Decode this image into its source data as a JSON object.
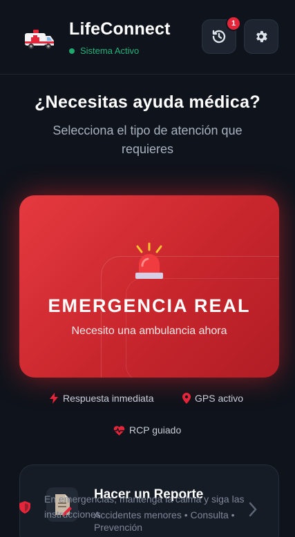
{
  "header": {
    "app_name": "LifeConnect",
    "status": "Sistema Activo",
    "history_badge": "1",
    "icons": {
      "logo": "ambulance-icon",
      "history": "history-icon",
      "settings": "gear-icon"
    }
  },
  "main": {
    "question": "¿Necesitas ayuda médica?",
    "subtitle": "Selecciona el tipo de atención que requieres"
  },
  "emergency": {
    "title": "EMERGENCIA REAL",
    "subtitle": "Necesito una ambulancia ahora",
    "icon": "siren-icon"
  },
  "features": [
    {
      "label": "Respuesta inmediata",
      "icon": "bolt-icon"
    },
    {
      "label": "GPS activo",
      "icon": "location-pin-icon"
    },
    {
      "label": "RCP guiado",
      "icon": "heartbeat-icon"
    }
  ],
  "report": {
    "title": "Hacer un Reporte",
    "subtitle": "Accidentes menores • Consulta • Prevención",
    "icon": "document-icon"
  },
  "toast": {
    "message": "En emergencias, mantenga la calma y siga las instrucciones"
  },
  "colors": {
    "background": "#0f131b",
    "emergency": "#d9303a",
    "status_green": "#22b37a",
    "badge": "#e5263a"
  }
}
